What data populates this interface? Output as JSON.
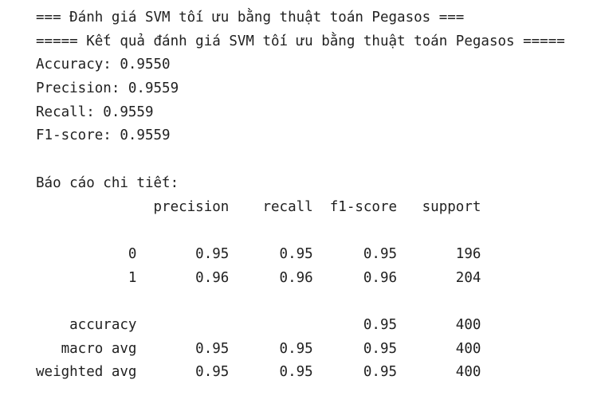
{
  "output_lines": [
    "=== Đánh giá SVM tối ưu bằng thuật toán Pegasos ===",
    "===== Kết quả đánh giá SVM tối ưu bằng thuật toán Pegasos =====",
    "Accuracy: 0.9550",
    "Precision: 0.9559",
    "Recall: 0.9559",
    "F1-score: 0.9559",
    "",
    "Báo cáo chi tiết:",
    "              precision    recall  f1-score   support",
    "",
    "           0       0.95      0.95      0.95       196",
    "           1       0.96      0.96      0.96       204",
    "",
    "    accuracy                           0.95       400",
    "   macro avg       0.95      0.95      0.95       400",
    "weighted avg       0.95      0.95      0.95       400"
  ],
  "colors": {
    "background": "#ffffff",
    "text": "#212121"
  }
}
